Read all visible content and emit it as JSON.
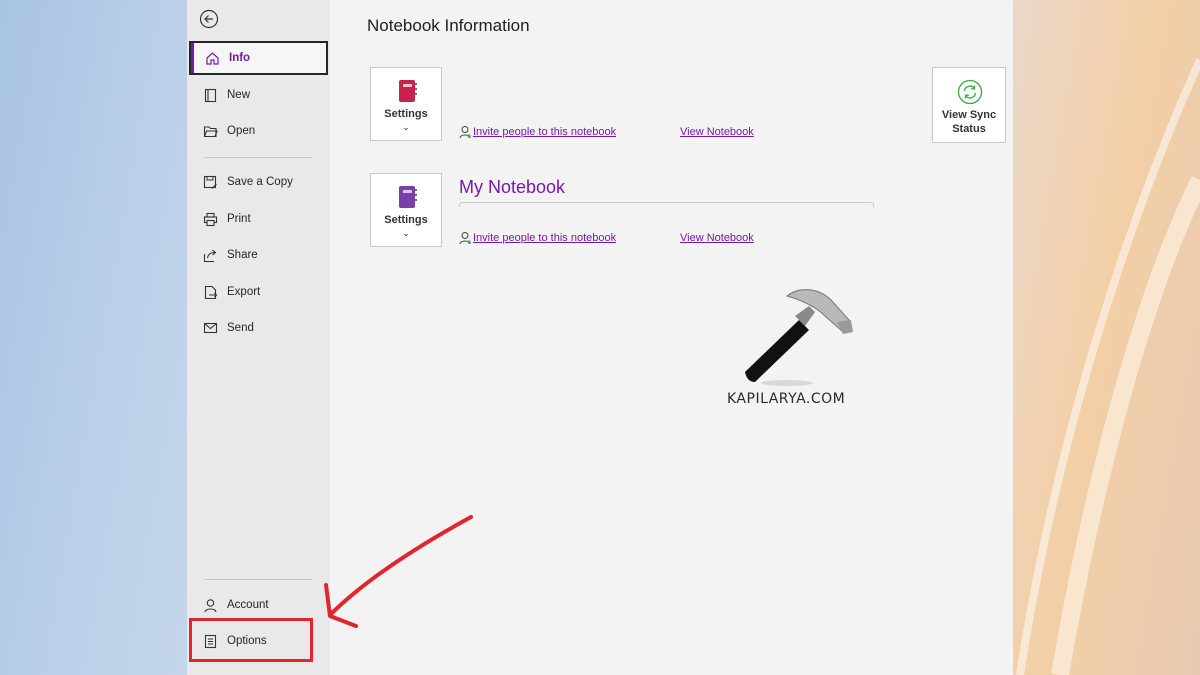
{
  "sidebar": {
    "back": "back-arrow-icon",
    "items": [
      {
        "label": "Info",
        "icon": "home-icon"
      },
      {
        "label": "New",
        "icon": "new-notebook-icon"
      },
      {
        "label": "Open",
        "icon": "folder-open-icon"
      },
      {
        "label": "Save a Copy",
        "icon": "save-copy-icon"
      },
      {
        "label": "Print",
        "icon": "printer-icon"
      },
      {
        "label": "Share",
        "icon": "share-icon"
      },
      {
        "label": "Export",
        "icon": "export-icon"
      },
      {
        "label": "Send",
        "icon": "send-icon"
      }
    ],
    "bottom_items": [
      {
        "label": "Account",
        "icon": "person-icon"
      },
      {
        "label": "Options",
        "icon": "options-icon"
      }
    ]
  },
  "main": {
    "title": "Notebook Information",
    "notebooks": [
      {
        "name": "",
        "settings_label": "Settings",
        "invite_label": "Invite people to this notebook",
        "view_label": "View Notebook",
        "color": "#c8214f"
      },
      {
        "name": "My Notebook",
        "settings_label": "Settings",
        "invite_label": "Invite people to this notebook",
        "view_label": "View Notebook",
        "color": "#7b3fa8"
      }
    ],
    "sync": {
      "line1": "View Sync",
      "line2": "Status"
    }
  },
  "watermark": {
    "text": "KAPILARYA.COM"
  },
  "colors": {
    "accent": "#7719aa",
    "highlight": "#e1252b",
    "sync": "#3aa845"
  }
}
